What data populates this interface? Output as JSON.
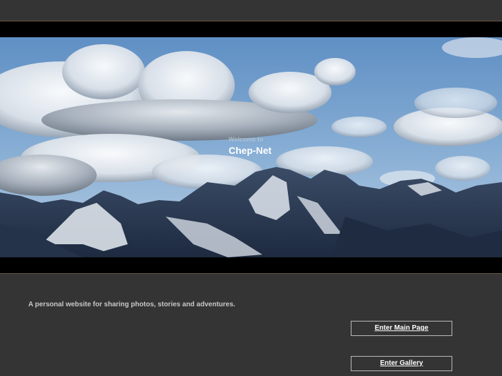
{
  "hero": {
    "welcome_text": "Welcome to",
    "site_name": "Chep-Net"
  },
  "tagline": "A personal website for sharing photos, stories and adventures.",
  "buttons": {
    "main_page_label": "Enter Main Page",
    "gallery_label": "Enter Gallery"
  },
  "colors": {
    "page_background": "#343434",
    "band": "#000000",
    "band_border": "#6b5a45",
    "button_border": "#bcbcbc"
  }
}
